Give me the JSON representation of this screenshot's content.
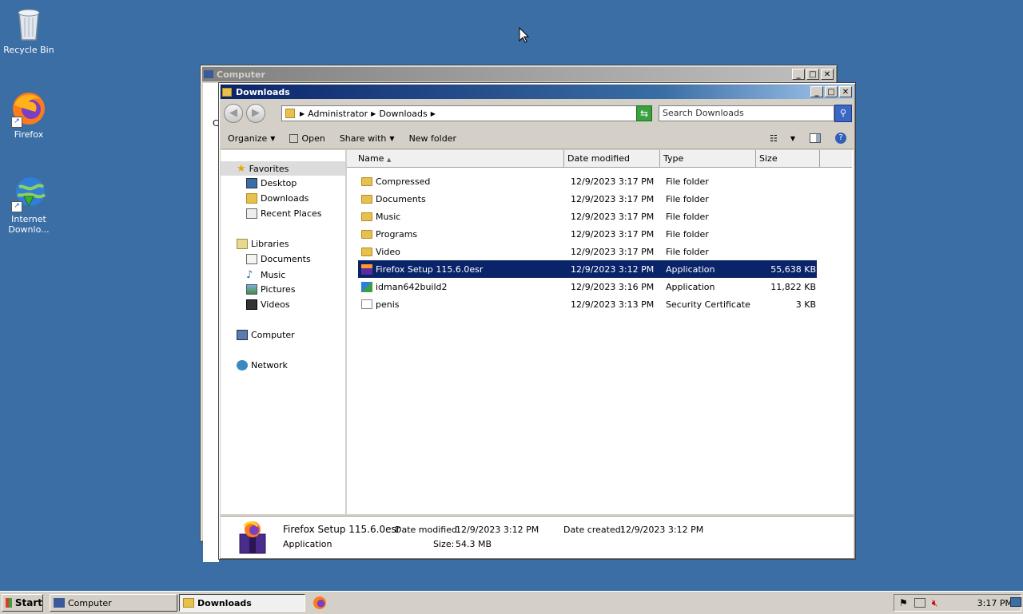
{
  "desktop": {
    "icons": [
      {
        "label": "Recycle Bin"
      },
      {
        "label": "Firefox"
      },
      {
        "label": "Internet Downlo..."
      }
    ]
  },
  "back_window": {
    "title": "Computer",
    "partial_label": "C"
  },
  "window": {
    "title": "Downloads",
    "breadcrumb": [
      "Administrator",
      "Downloads"
    ],
    "search_placeholder": "Search Downloads",
    "toolbar": {
      "organize": "Organize",
      "open": "Open",
      "share_with": "Share with",
      "new_folder": "New folder"
    },
    "nav": {
      "favorites": "Favorites",
      "favorites_items": [
        "Desktop",
        "Downloads",
        "Recent Places"
      ],
      "libraries": "Libraries",
      "libraries_items": [
        "Documents",
        "Music",
        "Pictures",
        "Videos"
      ],
      "computer": "Computer",
      "network": "Network"
    },
    "columns": {
      "name": "Name",
      "date": "Date modified",
      "type": "Type",
      "size": "Size"
    },
    "files": [
      {
        "name": "Compressed",
        "date": "12/9/2023 3:17 PM",
        "type": "File folder",
        "size": "",
        "kind": "folder"
      },
      {
        "name": "Documents",
        "date": "12/9/2023 3:17 PM",
        "type": "File folder",
        "size": "",
        "kind": "folder"
      },
      {
        "name": "Music",
        "date": "12/9/2023 3:17 PM",
        "type": "File folder",
        "size": "",
        "kind": "folder"
      },
      {
        "name": "Programs",
        "date": "12/9/2023 3:17 PM",
        "type": "File folder",
        "size": "",
        "kind": "folder"
      },
      {
        "name": "Video",
        "date": "12/9/2023 3:17 PM",
        "type": "File folder",
        "size": "",
        "kind": "folder"
      },
      {
        "name": "Firefox Setup 115.6.0esr",
        "date": "12/9/2023 3:12 PM",
        "type": "Application",
        "size": "55,638 KB",
        "kind": "firefox"
      },
      {
        "name": "idman642build2",
        "date": "12/9/2023 3:16 PM",
        "type": "Application",
        "size": "11,822 KB",
        "kind": "idm"
      },
      {
        "name": "penis",
        "date": "12/9/2023 3:13 PM",
        "type": "Security Certificate",
        "size": "3 KB",
        "kind": "cert"
      }
    ],
    "details": {
      "name": "Firefox Setup 115.6.0esr",
      "type": "Application",
      "date_modified_label": "Date modified:",
      "date_modified": "12/9/2023 3:12 PM",
      "date_created_label": "Date created:",
      "date_created": "12/9/2023 3:12 PM",
      "size_label": "Size:",
      "size": "54.3 MB"
    }
  },
  "taskbar": {
    "start": "Start",
    "tasks": [
      "Computer",
      "Downloads"
    ],
    "clock": "3:17 PM"
  },
  "colors": {
    "desktop": "#3a6ea5",
    "selection": "#0a246a"
  }
}
